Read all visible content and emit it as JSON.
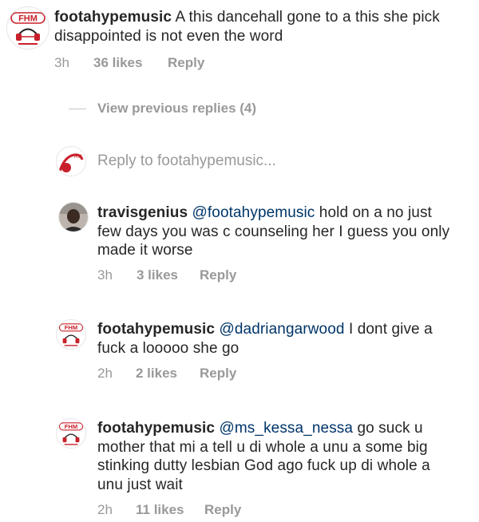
{
  "main_comment": {
    "username": "footahypemusic",
    "text": "A this dancehall gone to a this she pick disappointed is not even the word",
    "time": "3h",
    "likes": "36 likes",
    "reply": "Reply"
  },
  "view_previous": "View previous replies (4)",
  "reply_box": {
    "placeholder": "Reply to footahypemusic..."
  },
  "replies": [
    {
      "username": "travisgenius",
      "mention": "@footahypemusic",
      "text": "hold on a no just few days you was c counseling her I guess you only made it worse",
      "time": "3h",
      "likes": "3 likes",
      "reply": "Reply"
    },
    {
      "username": "footahypemusic",
      "mention": "@dadriangarwood",
      "text": "I dont give a fuck a looooo she go",
      "time": "2h",
      "likes": "2 likes",
      "reply": "Reply"
    },
    {
      "username": "footahypemusic",
      "mention": "@ms_kessa_nessa",
      "text": "go suck u mother that mi a tell u di whole a unu a some big stinking dutty lesbian God ago fuck up di whole a unu just wait",
      "time": "2h",
      "likes": "11 likes",
      "reply": "Reply"
    }
  ],
  "logo_text": "FHM",
  "colors": {
    "logo_red": "#c8202a",
    "meta_gray": "#999999",
    "mention_blue": "#003569"
  }
}
